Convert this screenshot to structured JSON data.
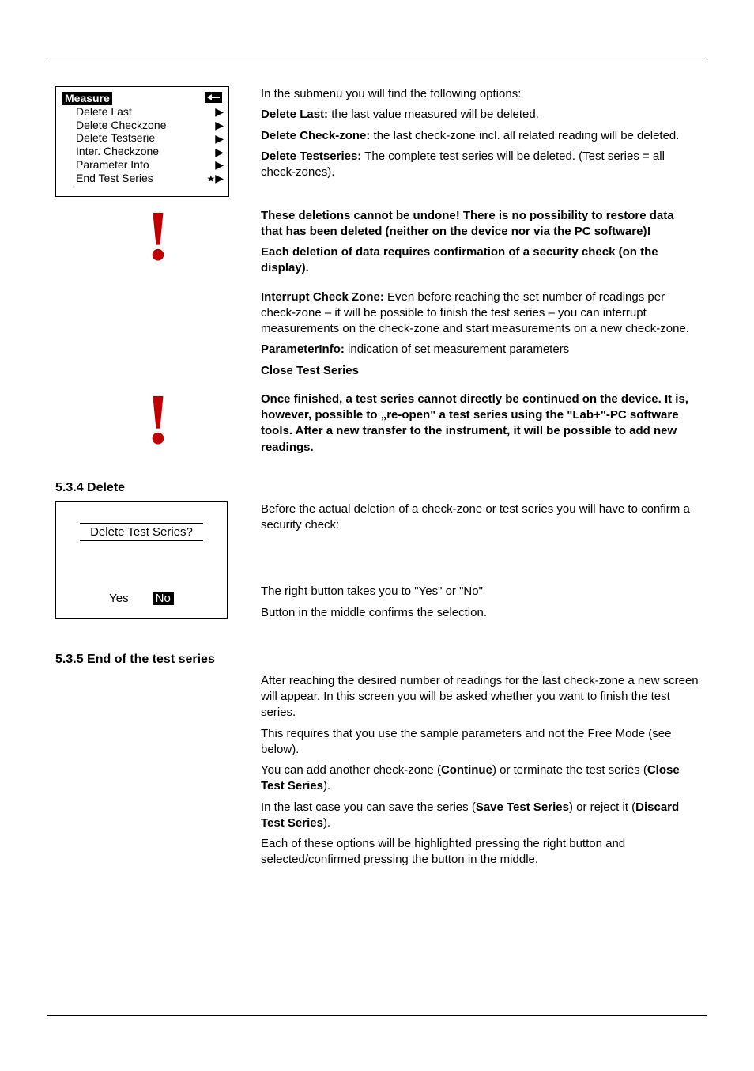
{
  "screen1": {
    "title": "Measure",
    "items": [
      "Delete Last",
      "Delete Checkzone",
      "Delete Testserie",
      "Inter. Checkzone",
      "Parameter Info",
      "End Test Series"
    ],
    "star": "★"
  },
  "desc_line1": "In the submenu you will find the following options:",
  "opt1": {
    "label": "Delete Last:",
    "body": "the last value measured will be deleted."
  },
  "opt2": {
    "label": "Delete Check-zone:",
    "body": "the last check-zone incl. all related reading will be deleted."
  },
  "opt3": {
    "label": "Delete Testseries:",
    "body": "The complete test series will be deleted. (Test series = all check-zones)."
  },
  "warn1_a": "These deletions cannot be undone! There is no possibility to restore data that has been deleted (neither on the device nor via the PC software)!",
  "warn1_b": "Each deletion of data requires confirmation of a security check (on the display).",
  "opt4": {
    "label": "Interrupt Check Zone:",
    "body": "Even before reaching the set number of readings per check-zone – it will be possible to finish the test series – you can interrupt measurements on the check-zone and start measurements on a new check-zone."
  },
  "opt5": {
    "label": "ParameterInfo:",
    "body": "indication of set measurement parameters"
  },
  "opt6": {
    "label": "Close Test Series",
    "body": ""
  },
  "warn2": "Once finished, a test series cannot directly be continued on the device. It is, however, possible to „re-open\" a test series using the \"Lab+\"-PC software tools. After a new transfer to the instrument, it will be possible to add new readings.",
  "heading_del": "5.3.4 Delete",
  "del_para": "Before the actual deletion of a check-zone or test series you will have to confirm a security check:",
  "dialog": {
    "question": "Delete Test Series?",
    "yes": "Yes",
    "no": "No"
  },
  "del_desc1": "The right button takes you to \"Yes\" or \"No\"",
  "del_desc2": "Button in the middle confirms the selection.",
  "heading_end": "5.3.5 End of the test series",
  "end_p1": "After reaching the desired number of readings for the last check-zone a new screen will appear. In this screen you will be asked whether you want to finish the test series.",
  "end_p2": "This requires that you use the sample parameters and not the Free Mode (see below).",
  "end_p3_a": "You can add another check-zone (",
  "end_p3_b": "Continue",
  "end_p3_c": ") or terminate the test series (",
  "end_p3_d": "Close Test Series",
  "end_p3_e": ").",
  "end_p4_a": "In the last case you can save the series (",
  "end_p4_b": "Save Test Series",
  "end_p4_c": ") or reject it (",
  "end_p4_d": "Discard Test Series",
  "end_p4_e": ").",
  "end_p5": "Each of these options will be highlighted pressing the right button and selected/confirmed pressing the button in the middle."
}
